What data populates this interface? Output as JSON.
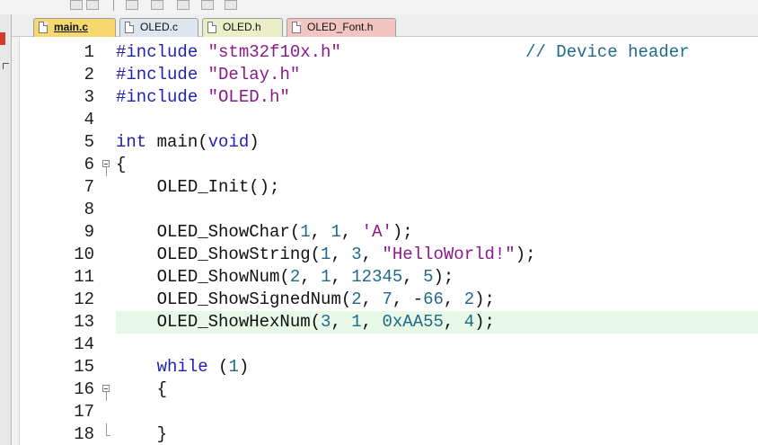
{
  "tabs": [
    {
      "label": "main.c",
      "active": true
    },
    {
      "label": "OLED.c",
      "active": false
    },
    {
      "label": "OLED.h",
      "active": false
    },
    {
      "label": "OLED_Font.h",
      "active": false
    }
  ],
  "lines": [
    {
      "num": "1",
      "parts": [
        {
          "t": "#include ",
          "c": "pp"
        },
        {
          "t": "\"stm32f10x.h\"",
          "c": "str"
        },
        {
          "t": "                  ",
          "c": ""
        },
        {
          "t": "// Device header",
          "c": "cmt"
        }
      ]
    },
    {
      "num": "2",
      "parts": [
        {
          "t": "#include ",
          "c": "pp"
        },
        {
          "t": "\"Delay.h\"",
          "c": "str"
        }
      ]
    },
    {
      "num": "3",
      "parts": [
        {
          "t": "#include ",
          "c": "pp"
        },
        {
          "t": "\"OLED.h\"",
          "c": "str"
        }
      ]
    },
    {
      "num": "4",
      "parts": []
    },
    {
      "num": "5",
      "parts": [
        {
          "t": "int",
          "c": "kw"
        },
        {
          "t": " main(",
          "c": ""
        },
        {
          "t": "void",
          "c": "kw"
        },
        {
          "t": ")",
          "c": ""
        }
      ]
    },
    {
      "num": "6",
      "parts": [
        {
          "t": "{",
          "c": ""
        }
      ],
      "fold": "open"
    },
    {
      "num": "7",
      "parts": [
        {
          "t": "    OLED_Init();",
          "c": ""
        }
      ]
    },
    {
      "num": "8",
      "parts": []
    },
    {
      "num": "9",
      "parts": [
        {
          "t": "    OLED_ShowChar(",
          "c": ""
        },
        {
          "t": "1",
          "c": "num"
        },
        {
          "t": ", ",
          "c": ""
        },
        {
          "t": "1",
          "c": "num"
        },
        {
          "t": ", ",
          "c": ""
        },
        {
          "t": "'A'",
          "c": "str"
        },
        {
          "t": ");",
          "c": ""
        }
      ]
    },
    {
      "num": "10",
      "parts": [
        {
          "t": "    OLED_ShowString(",
          "c": ""
        },
        {
          "t": "1",
          "c": "num"
        },
        {
          "t": ", ",
          "c": ""
        },
        {
          "t": "3",
          "c": "num"
        },
        {
          "t": ", ",
          "c": ""
        },
        {
          "t": "\"HelloWorld!\"",
          "c": "str"
        },
        {
          "t": ");",
          "c": ""
        }
      ]
    },
    {
      "num": "11",
      "parts": [
        {
          "t": "    OLED_ShowNum(",
          "c": ""
        },
        {
          "t": "2",
          "c": "num"
        },
        {
          "t": ", ",
          "c": ""
        },
        {
          "t": "1",
          "c": "num"
        },
        {
          "t": ", ",
          "c": ""
        },
        {
          "t": "12345",
          "c": "num"
        },
        {
          "t": ", ",
          "c": ""
        },
        {
          "t": "5",
          "c": "num"
        },
        {
          "t": ");",
          "c": ""
        }
      ]
    },
    {
      "num": "12",
      "parts": [
        {
          "t": "    OLED_ShowSignedNum(",
          "c": ""
        },
        {
          "t": "2",
          "c": "num"
        },
        {
          "t": ", ",
          "c": ""
        },
        {
          "t": "7",
          "c": "num"
        },
        {
          "t": ", -",
          "c": ""
        },
        {
          "t": "66",
          "c": "num"
        },
        {
          "t": ", ",
          "c": ""
        },
        {
          "t": "2",
          "c": "num"
        },
        {
          "t": ");",
          "c": ""
        }
      ]
    },
    {
      "num": "13",
      "parts": [
        {
          "t": "    OLED_ShowHexNum(",
          "c": ""
        },
        {
          "t": "3",
          "c": "num"
        },
        {
          "t": ", ",
          "c": ""
        },
        {
          "t": "1",
          "c": "num"
        },
        {
          "t": ", ",
          "c": ""
        },
        {
          "t": "0xAA55",
          "c": "num"
        },
        {
          "t": ", ",
          "c": ""
        },
        {
          "t": "4",
          "c": "num"
        },
        {
          "t": ");",
          "c": ""
        }
      ],
      "current": true
    },
    {
      "num": "14",
      "parts": []
    },
    {
      "num": "15",
      "parts": [
        {
          "t": "    ",
          "c": ""
        },
        {
          "t": "while",
          "c": "kw"
        },
        {
          "t": " (",
          "c": ""
        },
        {
          "t": "1",
          "c": "num"
        },
        {
          "t": ")",
          "c": ""
        }
      ]
    },
    {
      "num": "16",
      "parts": [
        {
          "t": "    {",
          "c": ""
        }
      ],
      "fold": "open"
    },
    {
      "num": "17",
      "parts": []
    },
    {
      "num": "18",
      "parts": [
        {
          "t": "    }",
          "c": ""
        }
      ],
      "fold": "end"
    }
  ]
}
